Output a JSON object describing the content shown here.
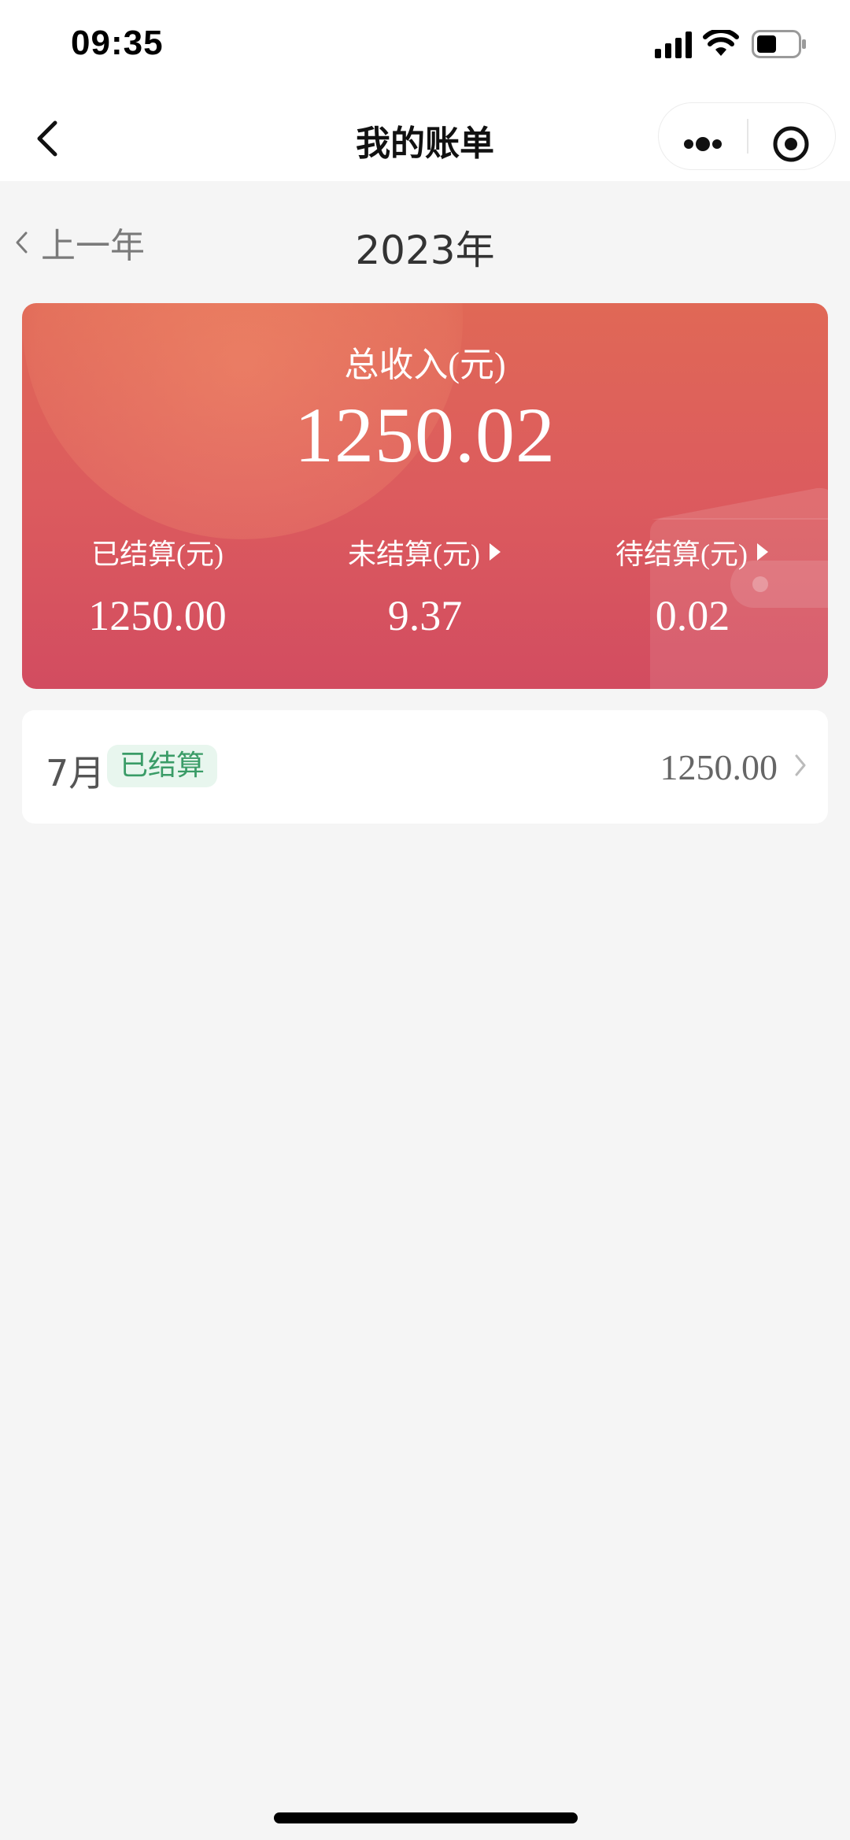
{
  "status_bar": {
    "time": "09:35",
    "icons": [
      "signal-icon",
      "wifi-icon",
      "battery-icon"
    ]
  },
  "nav": {
    "title": "我的账单",
    "icons": [
      "back-chevron-icon",
      "more-dots-icon",
      "target-close-icon"
    ]
  },
  "year_selector": {
    "prev_label": "上一年",
    "current_year": "2023年"
  },
  "summary": {
    "title": "总收入(元)",
    "total": "1250.02",
    "stats": {
      "settled": {
        "label": "已结算(元)",
        "value": "1250.00"
      },
      "unsettled": {
        "label": "未结算(元)",
        "value": "9.37"
      },
      "pending": {
        "label": "待结算(元)",
        "value": "0.02"
      }
    }
  },
  "months": [
    {
      "month": "7月",
      "status": "已结算",
      "amount": "1250.00"
    }
  ],
  "colors": {
    "card_top": "#e06856",
    "card_bottom": "#d24c60",
    "badge_bg": "#e8f6ee",
    "badge_text": "#3a9c67",
    "page_bg": "#f5f5f5"
  }
}
